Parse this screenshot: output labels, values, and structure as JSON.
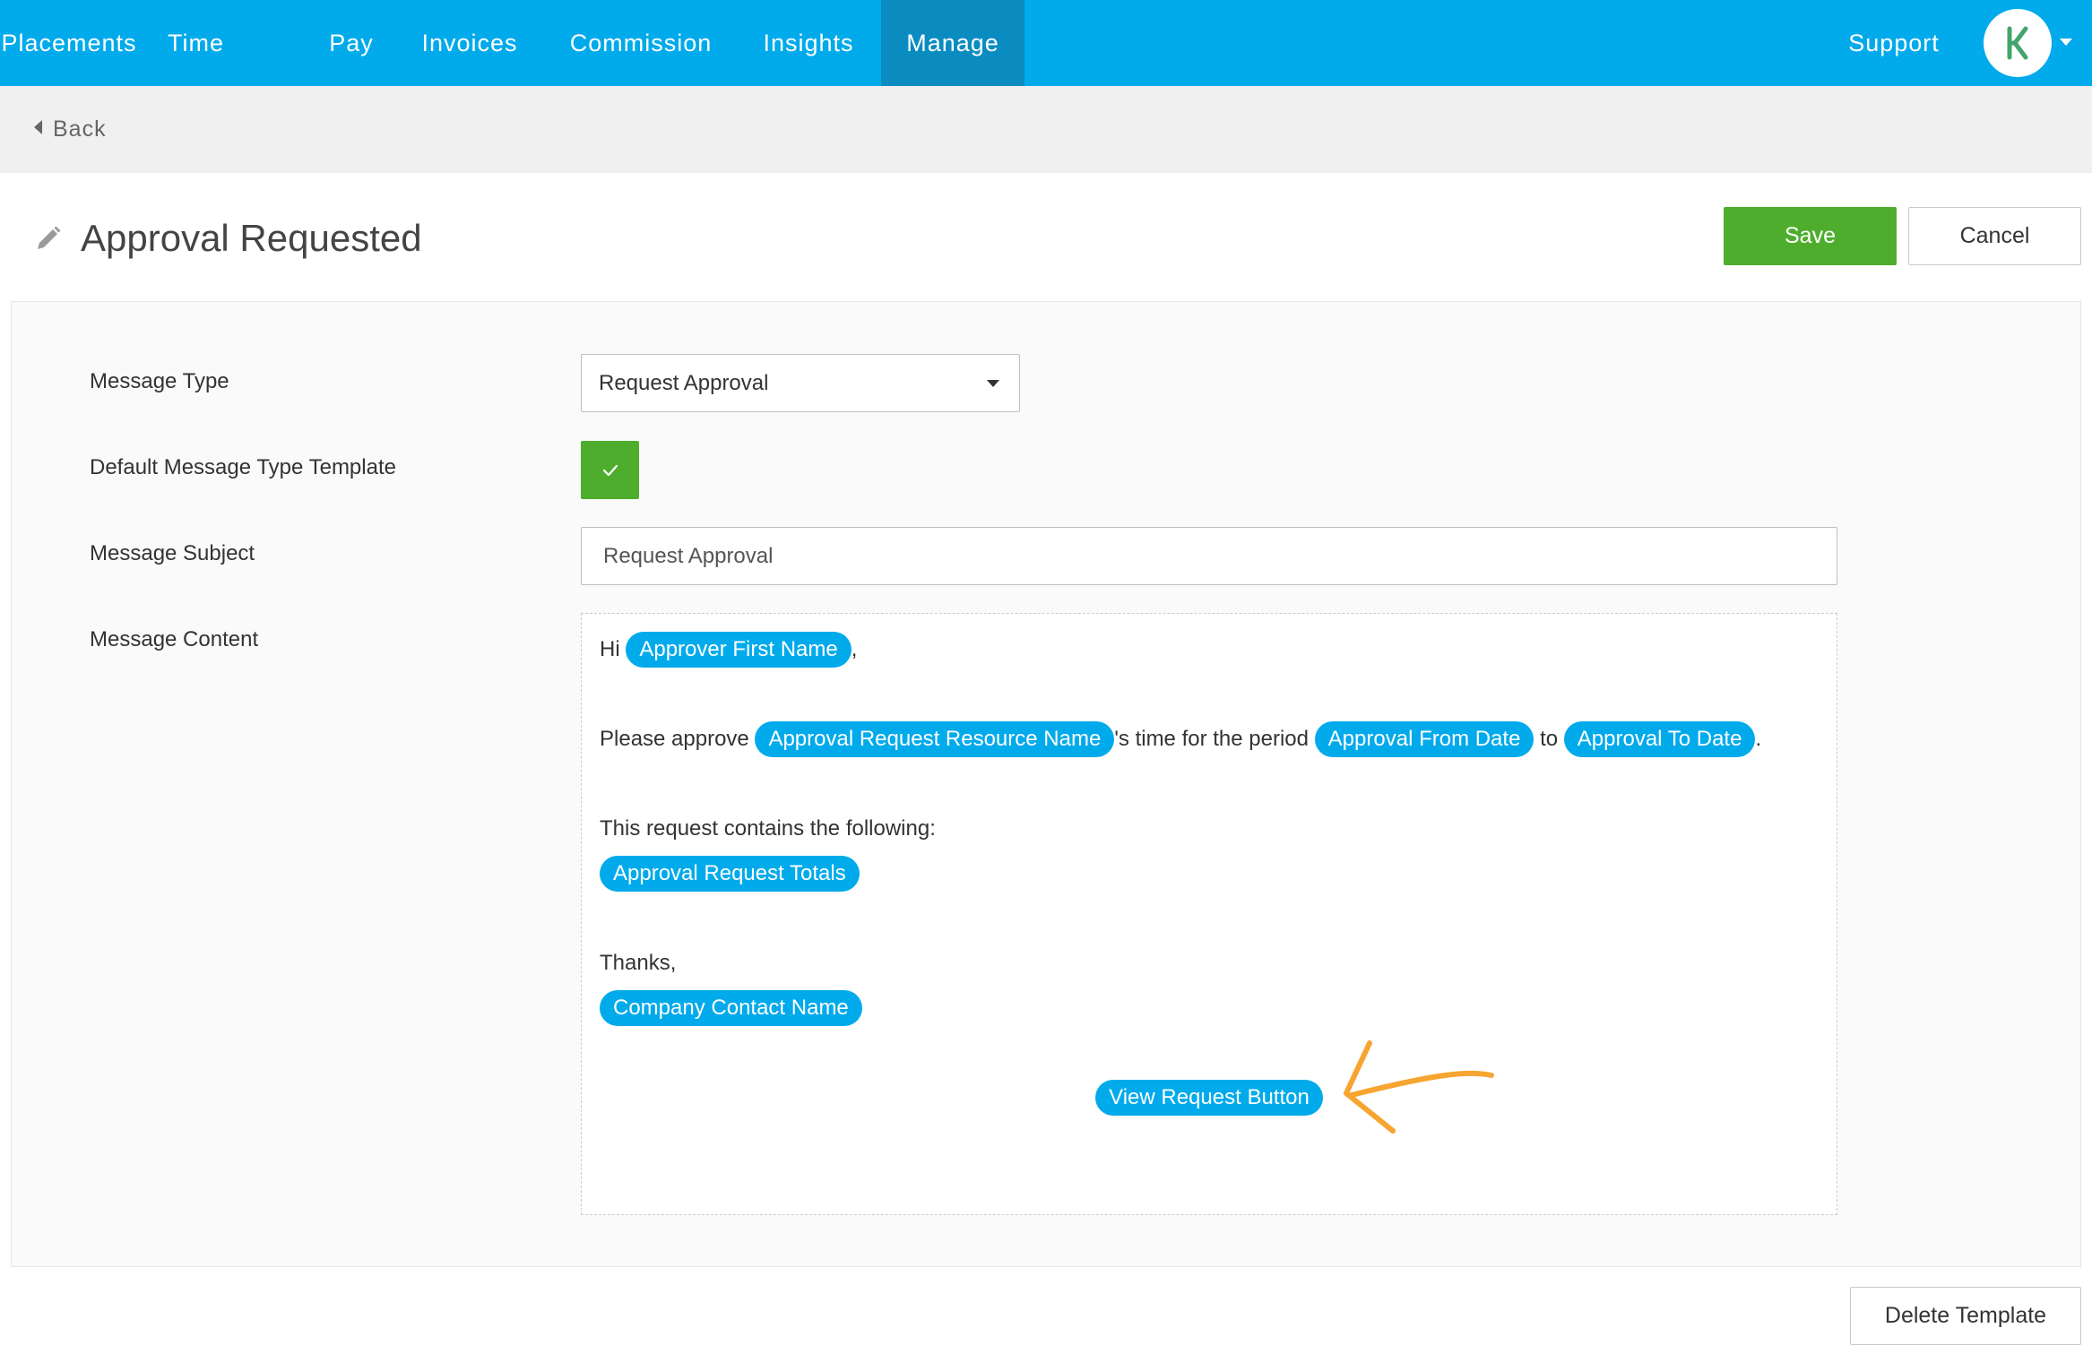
{
  "nav": {
    "items": [
      {
        "label": "Placements"
      },
      {
        "label": "Time"
      },
      {
        "label": "Pay"
      },
      {
        "label": "Invoices"
      },
      {
        "label": "Commission"
      },
      {
        "label": "Insights"
      },
      {
        "label": "Manage",
        "active": true
      }
    ],
    "support_label": "Support",
    "avatar_icon": "k-logo-icon",
    "brand_color": "#00aaeb",
    "active_color": "#0a8cc0"
  },
  "back": {
    "label": "Back",
    "icon": "caret-left-icon"
  },
  "header": {
    "title": "Approval Requested",
    "edit_icon": "pencil-icon",
    "save_label": "Save",
    "cancel_label": "Cancel",
    "save_color": "#4fad2e"
  },
  "form": {
    "message_type": {
      "label": "Message Type",
      "value": "Request Approval"
    },
    "default_template": {
      "label": "Default Message Type Template",
      "checked": true
    },
    "subject": {
      "label": "Message Subject",
      "value": "Request Approval"
    },
    "content": {
      "label": "Message Content",
      "greeting": "Hi",
      "greeting_end": ",",
      "approve_prefix": "Please approve",
      "approve_mid": "'s time for the period",
      "approve_to": "to",
      "approve_end": ".",
      "contains_text": "This request contains the following:",
      "thanks_text": "Thanks,",
      "chips": {
        "approver_first_name": "Approver First Name",
        "resource_name": "Approval Request Resource Name",
        "from_date": "Approval From Date",
        "to_date": "Approval To Date",
        "totals": "Approval Request Totals",
        "company_contact": "Company Contact Name",
        "view_request_button": "View Request Button"
      },
      "chip_color": "#00aaeb",
      "annotation_arrow_color": "#f7a531"
    }
  },
  "footer": {
    "delete_label": "Delete Template"
  }
}
